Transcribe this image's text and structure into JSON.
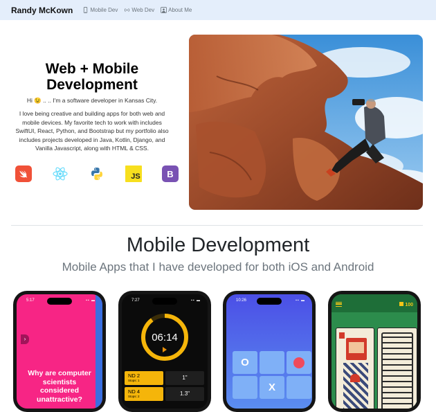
{
  "nav": {
    "brand": "Randy McKown",
    "links": [
      {
        "label": "Mobile Dev",
        "icon": "phone-icon"
      },
      {
        "label": "Web Dev",
        "icon": "broadcast-icon"
      },
      {
        "label": "About Me",
        "icon": "person-icon"
      }
    ]
  },
  "hero": {
    "title_line1": "Web + Mobile",
    "title_line2": "Development",
    "greeting": "Hi 😉 .. .. I'm a software developer in Kansas City.",
    "body": "I love being creative and building apps for both web and mobile devices. My favorite tech to work with includes SwiftUI, React, Python, and Bootstrap but my portfolio also includes projects developed in Java, Kotlin, Django, and Vanilla Javascript, along with HTML & CSS.",
    "tech_icons": [
      "swift-icon",
      "react-icon",
      "python-icon",
      "javascript-icon",
      "bootstrap-icon"
    ],
    "js_label": "JS",
    "bootstrap_label": "B"
  },
  "mobile": {
    "title": "Mobile Development",
    "subtitle": "Mobile Apps that I have developed for both iOS and Android"
  },
  "phones": {
    "p1": {
      "time": "5:17",
      "text": "Why are computer scientists considered unattractive?",
      "accent": "#f72585"
    },
    "p2": {
      "time": "7:27",
      "timer": "06:14",
      "laps": [
        {
          "name": "ND 2",
          "sub": "Stops: 1",
          "value": "1\""
        },
        {
          "name": "ND 4",
          "sub": "Stops: 2",
          "value": "1.3\""
        }
      ]
    },
    "p3": {
      "time": "10:26",
      "cell_o": "O",
      "cell_x": "X"
    },
    "p4": {
      "score": "100"
    }
  },
  "colors": {
    "nav_bg": "#e4eefb",
    "swift": "#f05138",
    "react": "#61dafb",
    "javascript": "#f7df1e",
    "bootstrap": "#7952b3",
    "timer_ring": "#f5b50a",
    "tile_blue": "#5b8ef0"
  }
}
